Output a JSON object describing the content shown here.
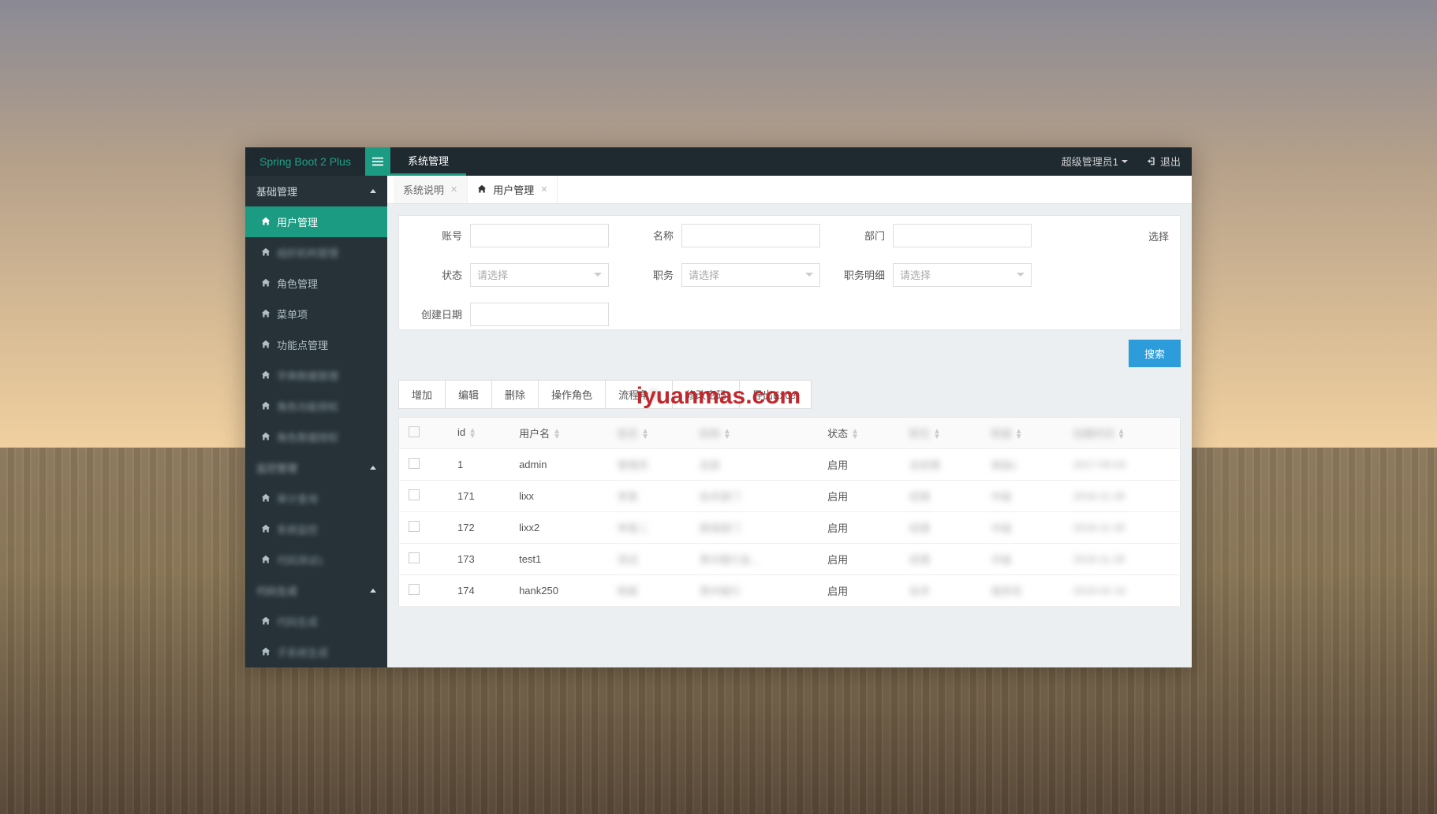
{
  "brand": "Spring Boot 2 Plus",
  "top_tab": "系统管理",
  "user": "超级管理员1",
  "logout": "退出",
  "sidebar": {
    "groups": [
      {
        "label": "基础管理",
        "items": [
          {
            "label": "用户管理",
            "active": true
          },
          {
            "label": "组织机构管理",
            "blur": true
          },
          {
            "label": "角色管理"
          },
          {
            "label": "菜单项"
          },
          {
            "label": "功能点管理"
          },
          {
            "label": "字典数据管理",
            "blur": true
          },
          {
            "label": "角色功能授权",
            "blur": true
          },
          {
            "label": "角色数据授权",
            "blur": true
          }
        ]
      },
      {
        "label": "监控管理",
        "blur": true,
        "items": [
          {
            "label": "审计查询",
            "blur": true
          },
          {
            "label": "系统监控",
            "blur": true
          },
          {
            "label": "代码测试1",
            "blur": true
          }
        ]
      },
      {
        "label": "代码生成",
        "blur": true,
        "items": [
          {
            "label": "代码生成",
            "blur": true
          },
          {
            "label": "子系统生成",
            "blur": true
          }
        ]
      }
    ]
  },
  "page_tabs": [
    {
      "label": "系统说明"
    },
    {
      "label": "用户管理",
      "active": true,
      "icon": true
    }
  ],
  "form": {
    "account": "账号",
    "name": "名称",
    "dept": "部门",
    "select": "选择",
    "status": "状态",
    "job": "职务",
    "job_detail": "职务明细",
    "create_date": "创建日期",
    "placeholder": "请选择",
    "search": "搜索"
  },
  "toolbar": [
    "增加",
    "编辑",
    "删除",
    "操作角色",
    "流程角色",
    "修改密码",
    "导出Excel"
  ],
  "table": {
    "headers": [
      "",
      "id",
      "用户名",
      "姓名",
      "机构",
      "状态",
      "职位",
      "职级",
      "创建时间"
    ],
    "rows": [
      {
        "id": "1",
        "username": "admin",
        "c3": "管理员",
        "c4": "总部",
        "status": "启用",
        "c6": "总经理",
        "c7": "高级1",
        "c8": "2017-09-03"
      },
      {
        "id": "171",
        "username": "lixx",
        "c3": "李某",
        "c4": "技术部门",
        "status": "启用",
        "c6": "经理",
        "c7": "中级",
        "c8": "2018-11-28"
      },
      {
        "id": "172",
        "username": "lixx2",
        "c3": "李某二",
        "c4": "跨境部门",
        "status": "启用",
        "c6": "经理",
        "c7": "中级",
        "c8": "2018-11-28"
      },
      {
        "id": "173",
        "username": "test1",
        "c3": "测试",
        "c4": "贵州银行金...",
        "status": "启用",
        "c6": "经理",
        "c7": "中级",
        "c8": "2018-11-28"
      },
      {
        "id": "174",
        "username": "hank250",
        "c3": "韩某",
        "c4": "贵州银行",
        "status": "启用",
        "c6": "技术",
        "c7": "程序员",
        "c8": "2019-02-16"
      }
    ]
  },
  "watermark": "iyuanmas.com"
}
